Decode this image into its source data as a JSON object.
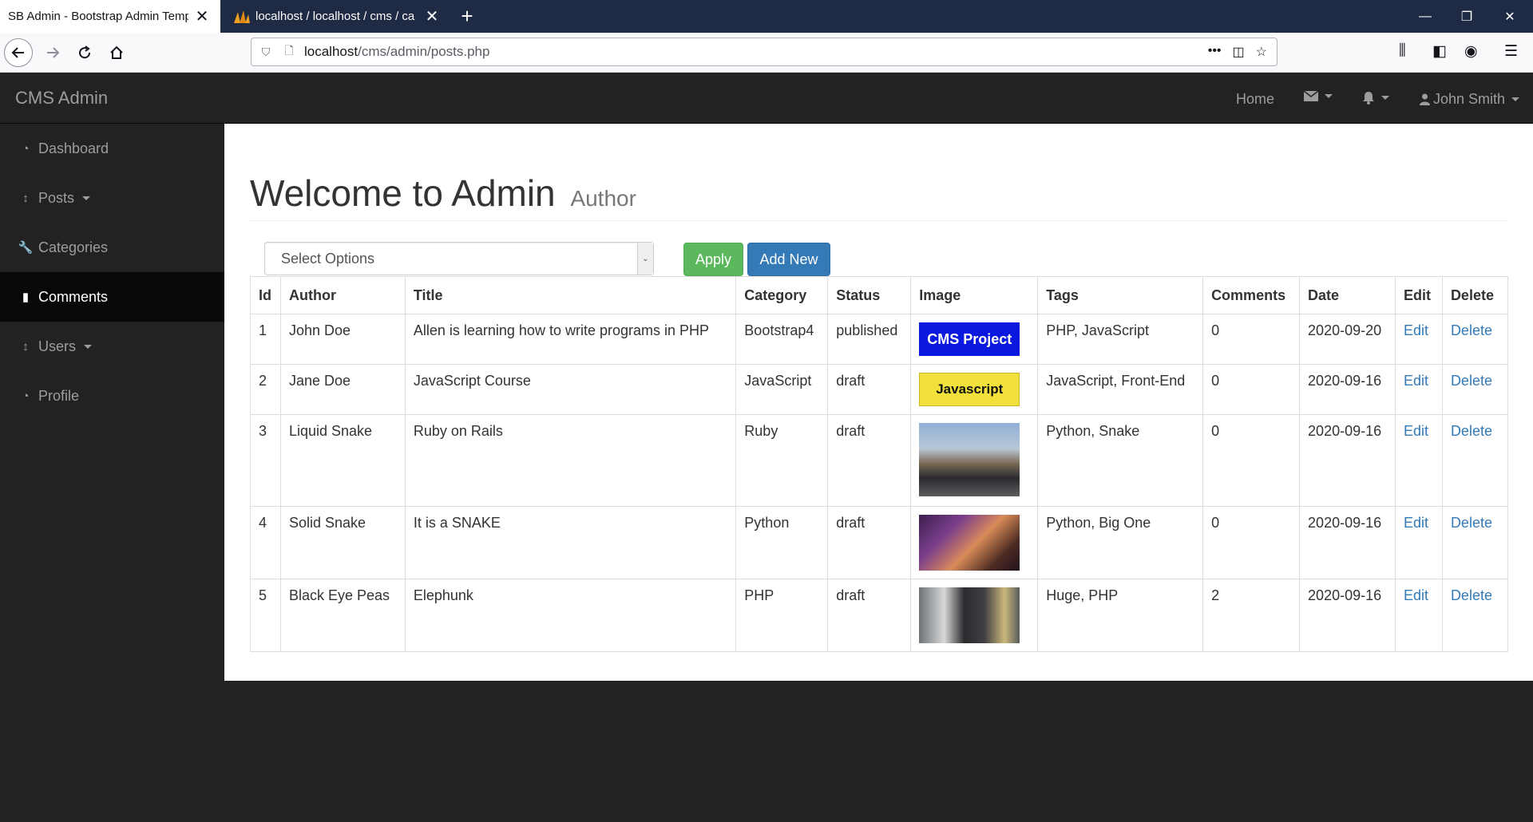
{
  "browser": {
    "tabs": [
      {
        "title": "SB Admin - Bootstrap Admin Temp",
        "close": "✕"
      },
      {
        "title": "localhost / localhost / cms / ca",
        "close": "✕"
      }
    ],
    "new_tab": "+",
    "url_host": "localhost",
    "url_path": "/cms/admin/posts.php",
    "url_actions": [
      "•••",
      "◫",
      "☆"
    ],
    "window_buttons": [
      "—",
      "❐",
      "✕"
    ]
  },
  "app": {
    "brand": "CMS Admin",
    "topnav": {
      "home": "Home",
      "user": "John Smith"
    }
  },
  "sidebar": {
    "items": [
      {
        "label": "Dashboard",
        "icon": "tachometer-icon"
      },
      {
        "label": "Posts",
        "icon": "arrows-v-icon"
      },
      {
        "label": "Categories",
        "icon": "wrench-icon"
      },
      {
        "label": "Comments",
        "icon": "file-icon"
      },
      {
        "label": "Users",
        "icon": "arrows-v-icon"
      },
      {
        "label": "Profile",
        "icon": "tachometer-icon"
      }
    ]
  },
  "main": {
    "title": "Welcome to Admin",
    "subtitle": "Author",
    "select_placeholder": "Select Options",
    "apply_label": "Apply",
    "add_new_label": "Add New",
    "columns": [
      "Id",
      "Author",
      "Title",
      "Category",
      "Status",
      "Image",
      "Tags",
      "Comments",
      "Date",
      "Edit",
      "Delete"
    ],
    "rows": [
      {
        "id": "1",
        "author": "John Doe",
        "title": "Allen is learning how to write programs in PHP",
        "category": "Bootstrap4",
        "status": "published",
        "image_text": "CMS Project",
        "tags": "PHP, JavaScript",
        "comments": "0",
        "date": "2020-09-20",
        "edit": "Edit",
        "delete": "Delete"
      },
      {
        "id": "2",
        "author": "Jane Doe",
        "title": "JavaScript Course",
        "category": "JavaScript",
        "status": "draft",
        "image_text": "Javascript",
        "tags": "JavaScript, Front-End",
        "comments": "0",
        "date": "2020-09-16",
        "edit": "Edit",
        "delete": "Delete"
      },
      {
        "id": "3",
        "author": "Liquid Snake",
        "title": "Ruby on Rails",
        "category": "Ruby",
        "status": "draft",
        "tags": "Python, Snake",
        "comments": "0",
        "date": "2020-09-16",
        "edit": "Edit",
        "delete": "Delete"
      },
      {
        "id": "4",
        "author": "Solid Snake",
        "title": "It is a SNAKE",
        "category": "Python",
        "status": "draft",
        "tags": "Python, Big One",
        "comments": "0",
        "date": "2020-09-16",
        "edit": "Edit",
        "delete": "Delete"
      },
      {
        "id": "5",
        "author": "Black Eye Peas",
        "title": "Elephunk",
        "category": "PHP",
        "status": "draft",
        "tags": "Huge, PHP",
        "comments": "2",
        "date": "2020-09-16",
        "edit": "Edit",
        "delete": "Delete"
      }
    ]
  },
  "colors": {
    "chrome_tabbar": "#1f2a44",
    "app_navbar": "#222222",
    "active_sidebar": "#080808",
    "apply_button": "#5cb85c",
    "add_new_button": "#337ab7",
    "link": "#337ab7"
  }
}
